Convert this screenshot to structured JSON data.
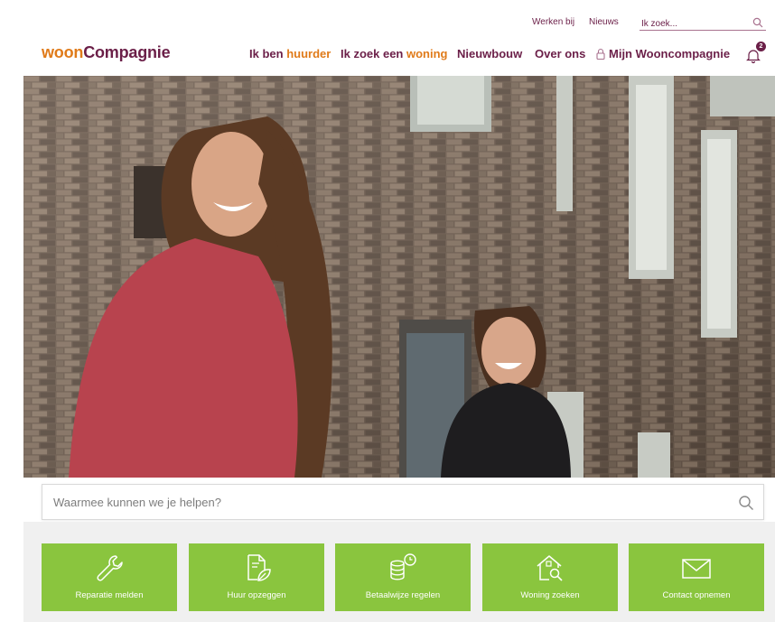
{
  "utility": {
    "links": [
      "Werken bij",
      "Nieuws"
    ],
    "search_placeholder": "Ik zoek..."
  },
  "header": {
    "logo_part1": "woon",
    "logo_part2": "Compagnie",
    "nav": {
      "huurder_a": "Ik ben ",
      "huurder_b": "huurder",
      "zoek_a": "Ik zoek een ",
      "zoek_b": "woning",
      "nieuwbouw": "Nieuwbouw",
      "over": "Over ons",
      "mijn": "Mijn Wooncompagnie"
    },
    "notification_count": "2"
  },
  "hero": {
    "icon": "photo-two-laughing-women"
  },
  "search": {
    "placeholder": "Waarmee kunnen we je helpen?"
  },
  "tiles": [
    {
      "label": "Reparatie melden",
      "icon": "wrench-icon"
    },
    {
      "label": "Huur opzeggen",
      "icon": "document-leaf-icon"
    },
    {
      "label": "Betaalwijze regelen",
      "icon": "coins-clock-icon"
    },
    {
      "label": "Woning zoeken",
      "icon": "house-search-icon"
    },
    {
      "label": "Contact opnemen",
      "icon": "envelope-icon"
    }
  ],
  "colors": {
    "brand_purple": "#6b1f48",
    "brand_orange": "#e07b1a",
    "tile_green": "#8ac53e"
  }
}
